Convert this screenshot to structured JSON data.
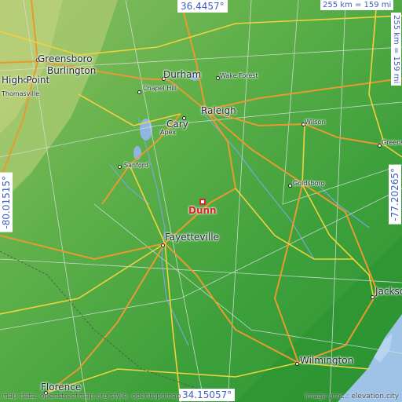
{
  "map": {
    "target": "Dunn",
    "top_coord": "36.4457°",
    "bottom_coord": "34.15057°",
    "left_coord": "-80.01515°",
    "right_coord": "-77.20265°",
    "scale": "255 km = 159 mi",
    "credit_left": "map data: openstreetmap.org style: opentopomap",
    "credit_right": "image proc.: elevation.city",
    "cities": {
      "greensboro": "Greensboro",
      "burlington": "Burlington",
      "high_point": "High Point",
      "thomasville": "Thomasville",
      "durham": "Durham",
      "wake_forest": "Wake Forest",
      "chapel_hill": "Chapel Hill",
      "raleigh": "Raleigh",
      "cary": "Cary",
      "apex": "Apex",
      "wilson": "Wilson",
      "greenville": "Greenville",
      "sanford": "Sanford",
      "goldsboro": "Goldsboro",
      "fayetteville": "Fayetteville",
      "jacksonville": "Jacksonville",
      "florence": "Florence",
      "wilmington": "Wilmington"
    }
  }
}
